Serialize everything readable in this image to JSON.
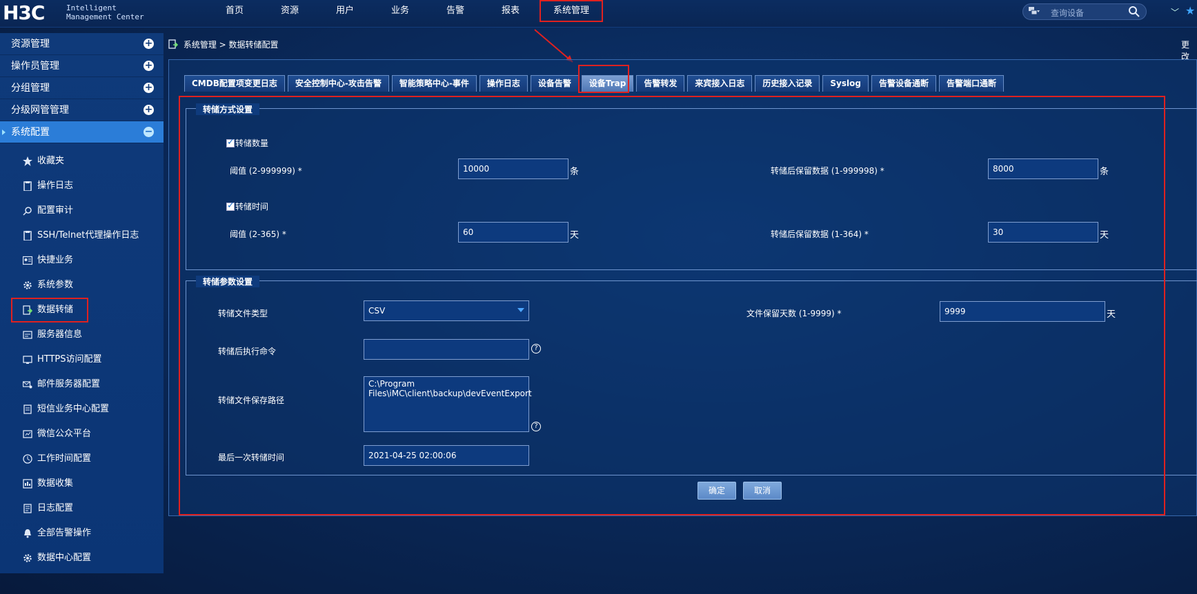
{
  "logo": {
    "brand": "H3C",
    "line1": "Intelligent",
    "line2": "Management Center"
  },
  "nav": [
    "首页",
    "资源",
    "用户",
    "业务",
    "告警",
    "报表",
    "系统管理"
  ],
  "search": {
    "placeholder": "查询设备"
  },
  "sidebar": {
    "groups": [
      "资源管理",
      "操作员管理",
      "分组管理",
      "分级网管管理",
      "系统配置"
    ],
    "items": [
      {
        "label": "收藏夹",
        "icon": "star-icon"
      },
      {
        "label": "操作日志",
        "icon": "clipboard-icon"
      },
      {
        "label": "配置审计",
        "icon": "search-doc-icon"
      },
      {
        "label": "SSH/Telnet代理操作日志",
        "icon": "clipboard-icon"
      },
      {
        "label": "快捷业务",
        "icon": "id-card-icon"
      },
      {
        "label": "系统参数",
        "icon": "gear-icon"
      },
      {
        "label": "数据转储",
        "icon": "data-export-icon"
      },
      {
        "label": "服务器信息",
        "icon": "server-info-icon"
      },
      {
        "label": "HTTPS访问配置",
        "icon": "https-icon"
      },
      {
        "label": "邮件服务器配置",
        "icon": "mail-server-icon"
      },
      {
        "label": "短信业务中心配置",
        "icon": "sms-icon"
      },
      {
        "label": "微信公众平台",
        "icon": "wechat-icon"
      },
      {
        "label": "工作时间配置",
        "icon": "clock-icon"
      },
      {
        "label": "数据收集",
        "icon": "data-collect-icon"
      },
      {
        "label": "日志配置",
        "icon": "log-icon"
      },
      {
        "label": "全部告警操作",
        "icon": "alarm-icon"
      },
      {
        "label": "数据中心配置",
        "icon": "gear-icon"
      }
    ]
  },
  "breadcrumb": "系统管理 > 数据转储配置",
  "right_cut": "更改",
  "tabs": [
    "CMDB配置项变更日志",
    "安全控制中心-攻击告警",
    "智能策略中心-事件",
    "操作日志",
    "设备告警",
    "设备Trap",
    "告警转发",
    "来宾接入日志",
    "历史接入记录",
    "Syslog",
    "告警设备通断",
    "告警端口通断"
  ],
  "storage_mode": {
    "legend": "转储方式设置",
    "by_count": {
      "check_label": "转储数量",
      "threshold_label": "阈值 (2-999999) *",
      "threshold_value": "10000",
      "threshold_unit": "条",
      "keep_label": "转储后保留数据 (1-999998) *",
      "keep_value": "8000",
      "keep_unit": "条"
    },
    "by_time": {
      "check_label": "转储时间",
      "threshold_label": "阈值 (2-365) *",
      "threshold_value": "60",
      "threshold_unit": "天",
      "keep_label": "转储后保留数据 (1-364) *",
      "keep_value": "30",
      "keep_unit": "天"
    }
  },
  "params": {
    "legend": "转储参数设置",
    "file_type_label": "转储文件类型",
    "file_type_value": "CSV",
    "retain_days_label": "文件保留天数 (1-9999) *",
    "retain_days_value": "9999",
    "retain_days_unit": "天",
    "command_label": "转储后执行命令",
    "command_value": "",
    "path_label": "转储文件保存路径",
    "path_value": "C:\\Program\nFiles\\iMC\\client\\backup\\devEventExport",
    "last_time_label": "最后一次转储时间",
    "last_time_value": "2021-04-25 02:00:06"
  },
  "buttons": {
    "ok": "确定",
    "cancel": "取消"
  },
  "colors": {
    "highlight": "#e0211f",
    "accent": "#2b7dd8"
  }
}
